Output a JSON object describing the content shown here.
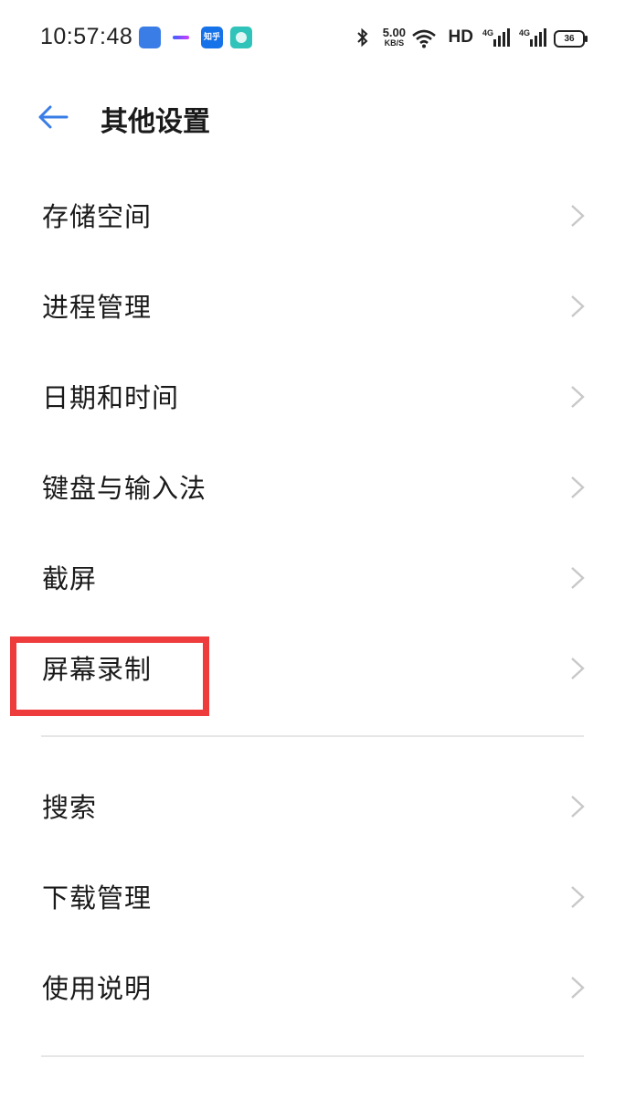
{
  "status_bar": {
    "time": "10:57:48",
    "zhihu_label": "知乎",
    "speed_value": "5.00",
    "speed_unit": "KB/S",
    "network_hd": "HD",
    "signal1_label": "4G",
    "signal2_label": "4G",
    "battery": "36"
  },
  "header": {
    "title": "其他设置"
  },
  "list_group_1": [
    {
      "label": "存储空间"
    },
    {
      "label": "进程管理"
    },
    {
      "label": "日期和时间"
    },
    {
      "label": "键盘与输入法"
    },
    {
      "label": "截屏"
    },
    {
      "label": "屏幕录制"
    }
  ],
  "list_group_2": [
    {
      "label": "搜索"
    },
    {
      "label": "下载管理"
    },
    {
      "label": "使用说明"
    }
  ],
  "colors": {
    "accent": "#3a7de6",
    "highlight": "#ee3b3b",
    "chevron": "#c8c8c8",
    "divider": "#e6e6e6"
  },
  "icons": {
    "back": "arrow-left-icon",
    "chevron": "chevron-right-icon"
  }
}
